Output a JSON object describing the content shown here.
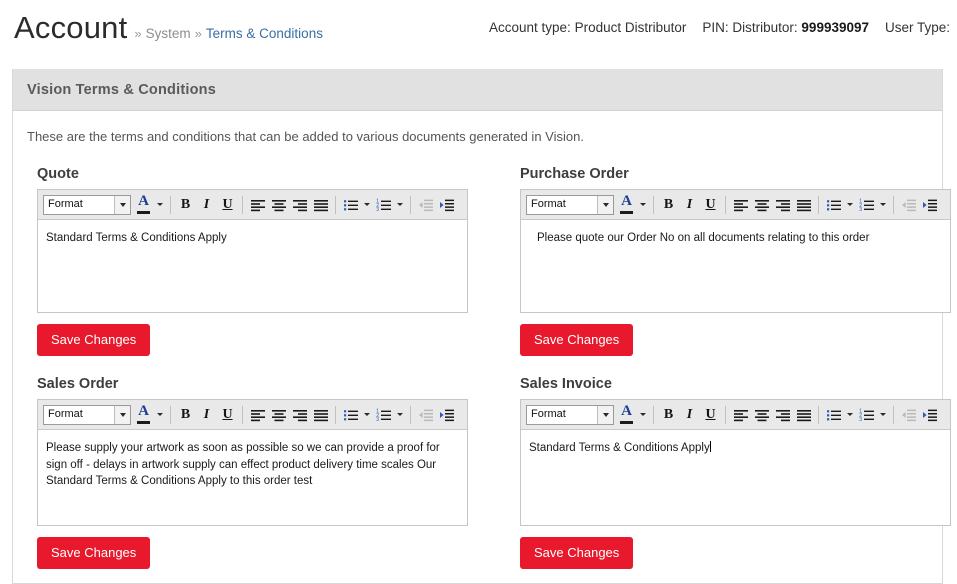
{
  "header": {
    "title": "Account",
    "separator": "»",
    "breadcrumb_system": "System",
    "breadcrumb_current": "Terms & Conditions",
    "account_type_label": "Account type:",
    "account_type_value": "Product Distributor",
    "pin_label": "PIN: Distributor:",
    "pin_value": "999939097",
    "user_type_label": "User Type:"
  },
  "panel": {
    "heading": "Vision Terms & Conditions",
    "intro": "These are the terms and conditions that can be added to various documents generated in Vision."
  },
  "toolbar": {
    "format_value": "Format",
    "bold": "B",
    "italic": "I",
    "underline": "U"
  },
  "buttons": {
    "save_changes": "Save Changes"
  },
  "editors": [
    {
      "label": "Quote",
      "content": "Standard Terms & Conditions Apply",
      "indented": false,
      "has_caret": false,
      "lines": [
        "Standard Terms & Conditions Apply"
      ]
    },
    {
      "label": "Purchase Order",
      "content": "Please quote our Order No on all documents relating to this order",
      "indented": true,
      "has_caret": false,
      "lines": [
        "Please quote our Order No on all documents relating to this order"
      ]
    },
    {
      "label": "Sales Order",
      "content": "Please supply your artwork as soon as possible so we can provide a proof for sign off - delays in artwork supply can effect product delivery time scales Our Standard Terms & Conditions Apply to this order   test",
      "indented": false,
      "has_caret": false,
      "lines": [
        "Please supply your artwork as soon as possible so we can provide a proof for",
        "sign off - delays in artwork supply can effect product delivery time scales Our",
        "Standard Terms & Conditions Apply to this order   test"
      ]
    },
    {
      "label": "Sales Invoice",
      "content": "Standard Terms & Conditions Apply",
      "indented": false,
      "has_caret": true,
      "lines": [
        "Standard Terms & Conditions Apply"
      ]
    }
  ],
  "icons": {
    "text_color": "text-color-icon",
    "bold": "bold-icon",
    "italic": "italic-icon",
    "underline": "underline-icon",
    "align_left": "align-left-icon",
    "align_center": "align-center-icon",
    "align_right": "align-right-icon",
    "align_justify": "align-justify-icon",
    "bullet_list": "bullet-list-icon",
    "numbered_list": "numbered-list-icon",
    "outdent": "outdent-icon",
    "indent": "indent-icon",
    "dropdown": "chevron-down-icon"
  }
}
